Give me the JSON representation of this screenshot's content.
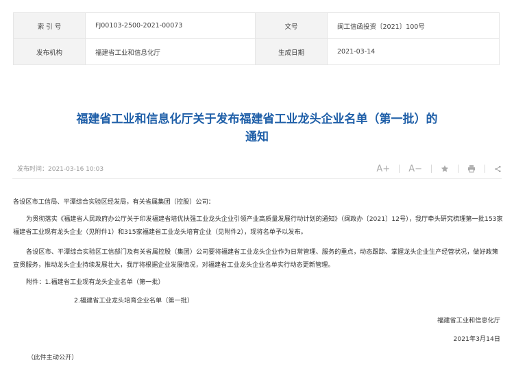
{
  "meta": {
    "index_label": "索 引 号",
    "index_value": "FJ00103-2500-2021-00073",
    "docno_label": "文号",
    "docno_value": "闽工信函投资〔2021〕100号",
    "publisher_label": "发布机构",
    "publisher_value": "福建省工业和信息化厅",
    "created_label": "生成日期",
    "created_value": "2021-03-14"
  },
  "article": {
    "title": "福建省工业和信息化厅关于发布福建省工业龙头企业名单（第一批）的通知",
    "publish_time": "发布时间：2021-03-16 10:03",
    "salutation": "各设区市工信局、平潭综合实验区经发局，有关省属集团（控股）公司：",
    "paragraph1": "为贯彻落实《福建省人民政府办公厅关于印发福建省培优扶强工业龙头企业引领产业高质量发展行动计划的通知》（闽政办〔2021〕12号），我厅牵头研究梳理第一批153家福建省工业现有龙头企业（见附件1）和315家福建省工业龙头培育企业（见附件2），现将名单予以发布。",
    "paragraph2": "各设区市、平潭综合实验区工信部门及有关省属控股（集团）公司要将福建省工业龙头企业作为日常管理、服务的重点，动态跟踪、掌握龙头企业生产经营状况，做好政策宣贯服务，推动龙头企业持续发展壮大，我厅将根据企业发展情况，对福建省工业龙头企业名单实行动态更新管理。",
    "attachment1": "附件：1.福建省工业现有龙头企业名单（第一批）",
    "attachment2": "2.福建省工业龙头培育企业名单（第一批）",
    "signature": "福建省工业和信息化厅",
    "date": "2021年3月14日",
    "public_note": "（此件主动公开）"
  },
  "toolbar": {
    "font_increase": "A+",
    "font_decrease": "A−",
    "favorite_icon": "star-icon",
    "print_icon": "print-icon",
    "share_icon": "share-icon"
  },
  "colors": {
    "title": "#1f5fa8",
    "label_bg": "#f3f3f3"
  }
}
